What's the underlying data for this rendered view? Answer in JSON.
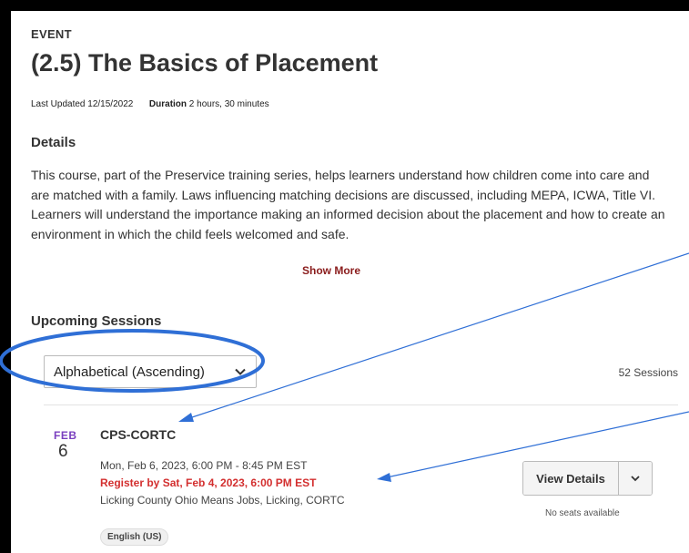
{
  "event": {
    "eyebrow": "EVENT",
    "title": "(2.5) The Basics of Placement",
    "last_updated_label": "Last Updated",
    "last_updated_value": "12/15/2022",
    "duration_label": "Duration",
    "duration_value": "2 hours, 30 minutes"
  },
  "details": {
    "heading": "Details",
    "text": "This course, part of the Preservice training series, helps learners understand how children come into care and are matched with a family. Laws influencing matching decisions are discussed, including MEPA, ICWA, Title VI.  Learners will understand the importance making an informed decision about the placement and how to create an environment in which the child feels welcomed and safe.",
    "show_more": "Show More"
  },
  "sessions": {
    "heading": "Upcoming Sessions",
    "sort_selected": "Alphabetical (Ascending)",
    "count": "52 Sessions",
    "items": [
      {
        "month": "FEB",
        "day": "6",
        "title": "CPS-CORTC",
        "time": "Mon, Feb 6, 2023, 6:00 PM - 8:45 PM EST",
        "register_by": "Register by Sat, Feb 4, 2023, 6:00 PM EST",
        "location": "Licking County Ohio Means Jobs, Licking, CORTC",
        "language": "English (US)",
        "button_label": "View Details",
        "availability": "No seats available"
      }
    ]
  },
  "colors": {
    "accent_purple": "#7a3fbf",
    "register_red": "#d32f2f",
    "show_more_red": "#8a1c1c",
    "annotation_blue": "#2f6fd6",
    "frame_black": "#000000"
  }
}
